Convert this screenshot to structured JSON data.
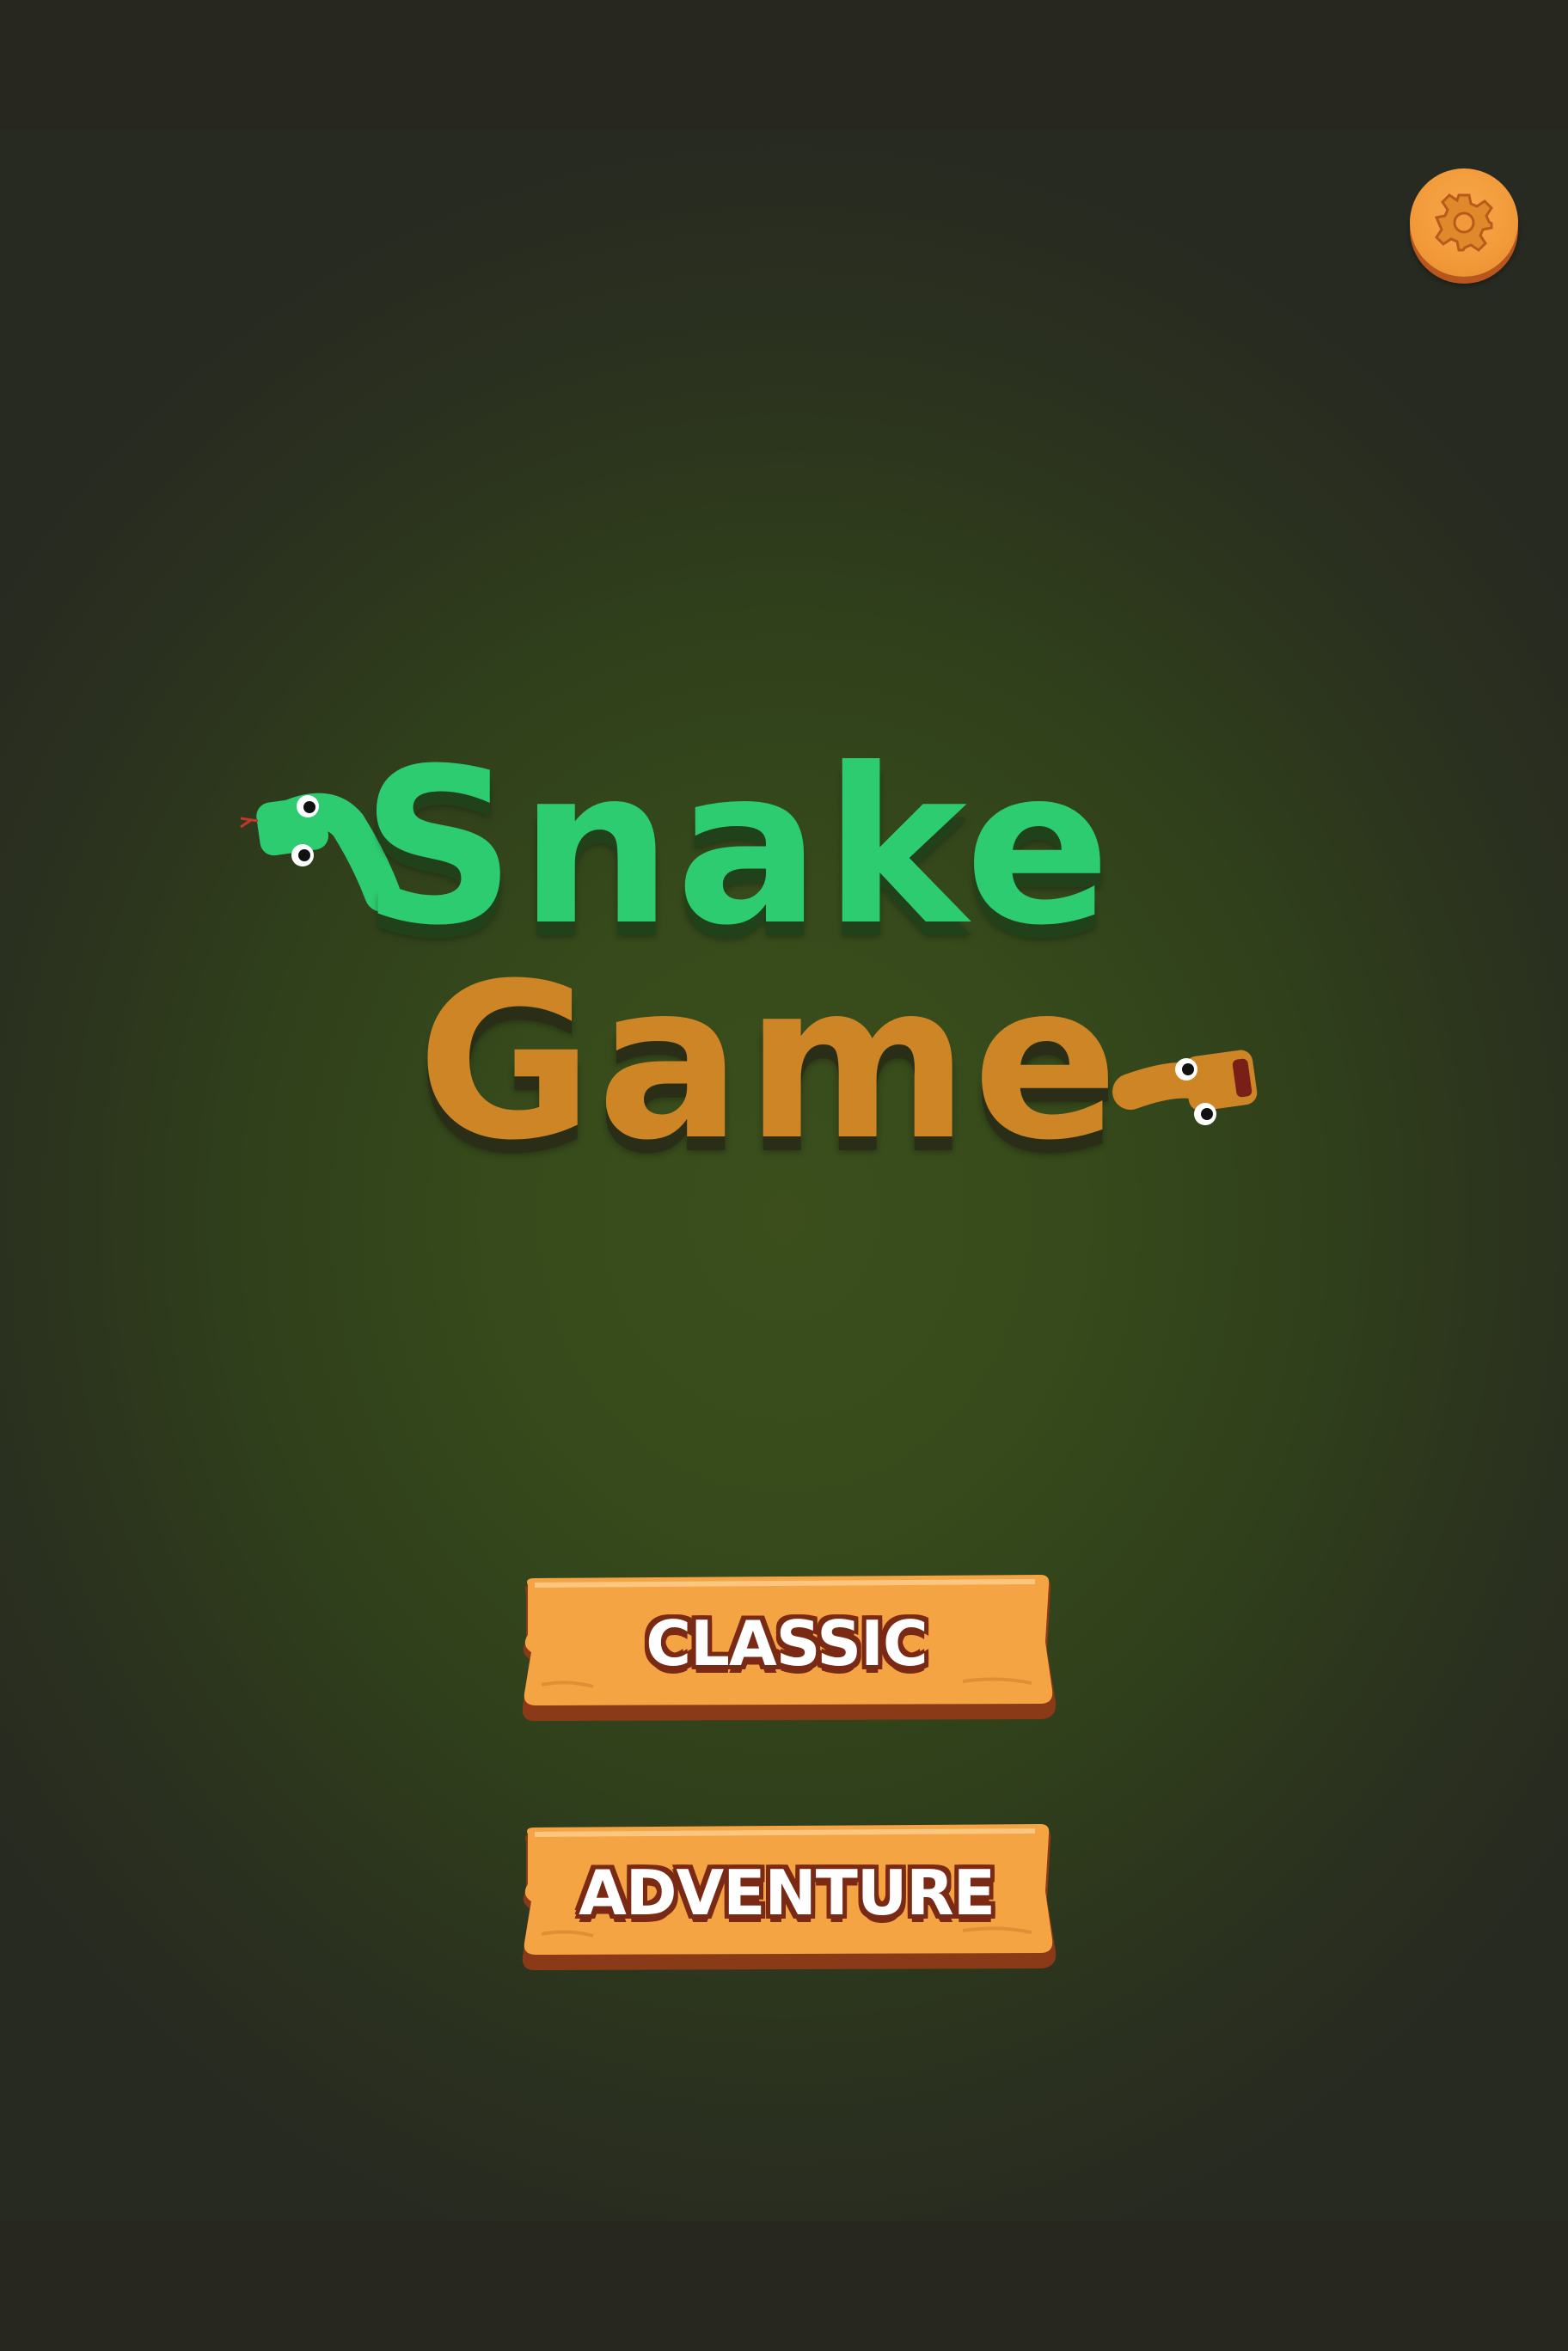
{
  "title": {
    "line1": "Snake",
    "line2": "Game"
  },
  "menu": {
    "classic_label": "CLASSIC",
    "adventure_label": "ADVENTURE"
  },
  "icons": {
    "settings": "gear-icon"
  },
  "colors": {
    "background": "#272720",
    "game_area_center": "#3b4e1c",
    "title_green": "#2ecc71",
    "title_orange": "#cd8525",
    "button_orange": "#f5a443",
    "button_edge": "#8a3a17",
    "settings_orange": "#f29a3a"
  }
}
